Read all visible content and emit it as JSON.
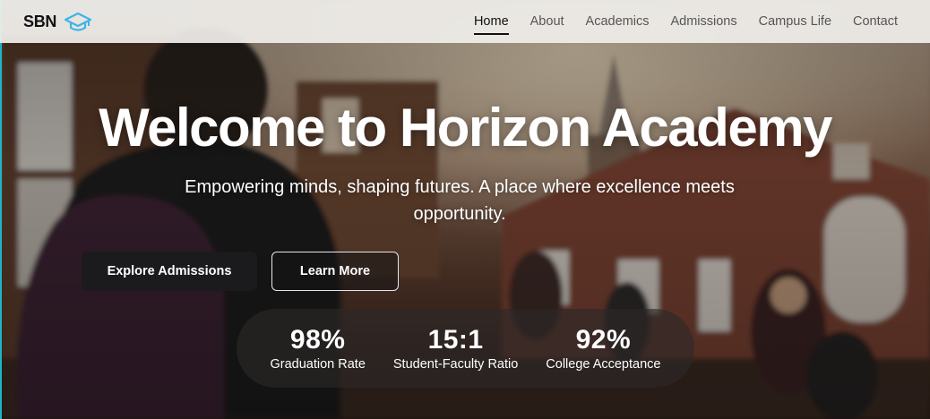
{
  "brand": {
    "name": "SBN",
    "icon": "graduation-cap-icon",
    "icon_color": "#3fb3e8"
  },
  "nav": {
    "items": [
      {
        "label": "Home",
        "active": true
      },
      {
        "label": "About",
        "active": false
      },
      {
        "label": "Academics",
        "active": false
      },
      {
        "label": "Admissions",
        "active": false
      },
      {
        "label": "Campus Life",
        "active": false
      },
      {
        "label": "Contact",
        "active": false
      }
    ]
  },
  "hero": {
    "title": "Welcome to Horizon Academy",
    "subtitle": "Empowering minds, shaping futures. A place where excellence meets opportunity.",
    "primary_button": "Explore Admissions",
    "secondary_button": "Learn More"
  },
  "stats": [
    {
      "value": "98%",
      "label": "Graduation Rate"
    },
    {
      "value": "15:1",
      "label": "Student-Faculty Ratio"
    },
    {
      "value": "92%",
      "label": "College Acceptance"
    }
  ]
}
